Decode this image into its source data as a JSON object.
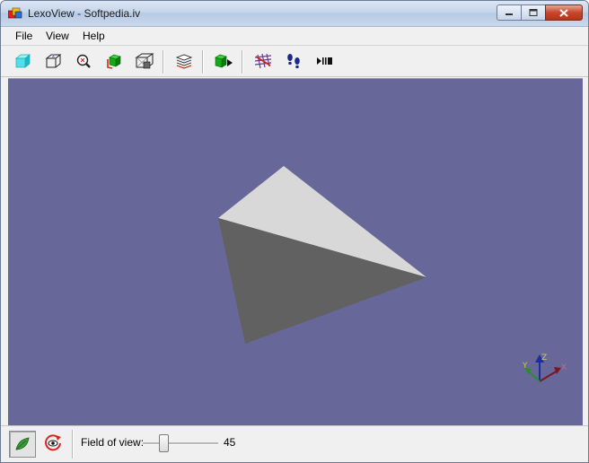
{
  "window": {
    "title": "LexoView - Softpedia.iv"
  },
  "menu": {
    "file": "File",
    "view": "View",
    "help": "Help"
  },
  "toolbar": {
    "buttons": [
      "view-all-icon",
      "view-box-icon",
      "zoom-icon",
      "color-icon",
      "wireframe-icon",
      "layers-icon",
      "render-icon",
      "grid-icon",
      "walk-icon",
      "play-pause-icon"
    ]
  },
  "viewport": {
    "background": "#686799",
    "axes": {
      "x": "X",
      "y": "Y",
      "z": "Z"
    }
  },
  "status": {
    "field_of_view_label": "Field of view:",
    "field_of_view_value": "45",
    "slider_fraction": 0.25
  },
  "colors": {
    "light_face": "#d8d8d8",
    "dark_face": "#616161"
  }
}
